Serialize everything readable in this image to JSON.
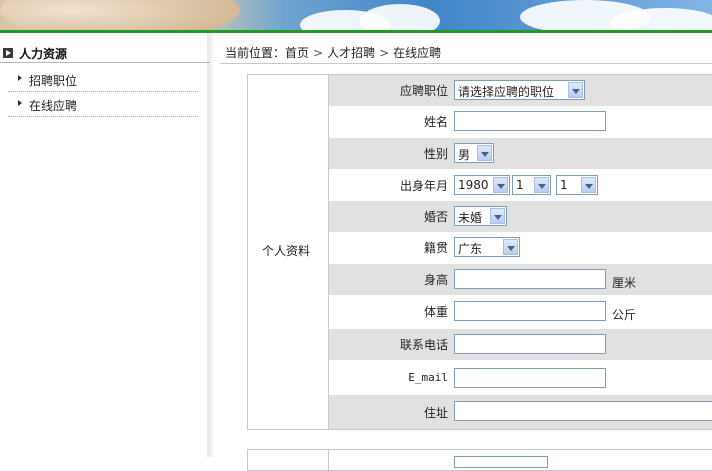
{
  "sidebar": {
    "title": "人力资源",
    "items": [
      {
        "label": "招聘职位"
      },
      {
        "label": "在线应聘"
      }
    ]
  },
  "breadcrumb": {
    "prefix": "当前位置：",
    "items": [
      "首页",
      "人才招聘",
      "在线应聘"
    ],
    "separator": ">"
  },
  "form": {
    "section_label": "个人资料",
    "position": {
      "label": "应聘职位",
      "value": "请选择应聘的职位"
    },
    "name": {
      "label": "姓名",
      "value": ""
    },
    "gender": {
      "label": "性别",
      "value": "男"
    },
    "birth": {
      "label": "出身年月",
      "year": "1980",
      "month": "1",
      "day": "1"
    },
    "marital": {
      "label": "婚否",
      "value": "未婚"
    },
    "hometown": {
      "label": "籍贯",
      "value": "广东"
    },
    "height": {
      "label": "身高",
      "value": "",
      "unit": "厘米"
    },
    "weight": {
      "label": "体重",
      "value": "",
      "unit": "公斤"
    },
    "phone": {
      "label": "联系电话",
      "value": ""
    },
    "email": {
      "label": "E_mail",
      "value": ""
    },
    "address": {
      "label": "住址",
      "value": ""
    }
  },
  "colors": {
    "accent_green": "#23982a",
    "row_shade": "#e1e1e1",
    "input_border": "#7f9db9"
  }
}
